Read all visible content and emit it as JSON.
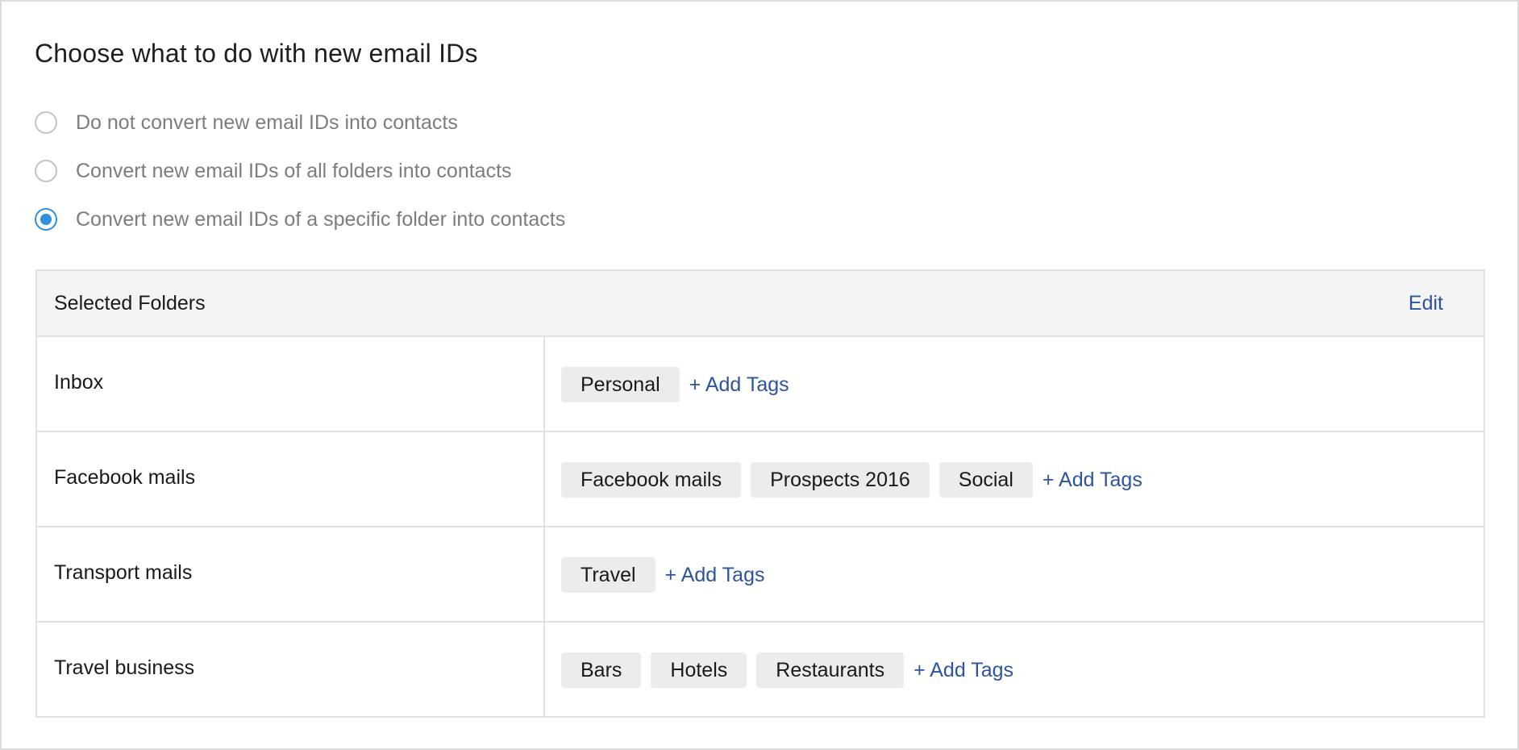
{
  "title": "Choose what to do with new email IDs",
  "options": [
    {
      "label": "Do not convert new email IDs into contacts",
      "checked": false
    },
    {
      "label": "Convert new email IDs of all folders into contacts",
      "checked": false
    },
    {
      "label": "Convert new email IDs of a specific folder into contacts",
      "checked": true
    }
  ],
  "folders": {
    "header": "Selected Folders",
    "edit_label": "Edit",
    "add_tags_label": "+ Add Tags",
    "rows": [
      {
        "name": "Inbox",
        "tags": [
          "Personal"
        ]
      },
      {
        "name": "Facebook mails",
        "tags": [
          "Facebook mails",
          "Prospects 2016",
          "Social"
        ]
      },
      {
        "name": "Transport mails",
        "tags": [
          "Travel"
        ]
      },
      {
        "name": "Travel business",
        "tags": [
          "Bars",
          "Hotels",
          "Restaurants"
        ]
      }
    ]
  },
  "colors": {
    "accent": "#2f8fe0",
    "link": "#2c54a0",
    "tag_bg": "#ececec",
    "header_bg": "#f4f4f4"
  }
}
